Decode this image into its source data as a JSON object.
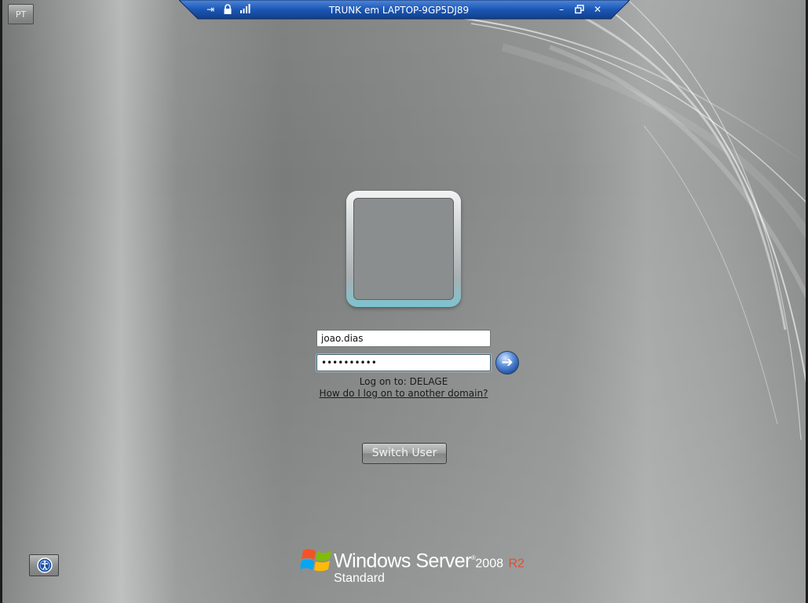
{
  "connection_bar": {
    "title": "TRUNK em LAPTOP-9GP5DJ89",
    "icons": [
      "pin-icon",
      "lock-icon",
      "signal-strength-icon",
      "minimize-icon",
      "restore-icon",
      "close-icon"
    ],
    "pin_glyph": "⇥",
    "minimize_glyph": "–",
    "close_glyph": "✕",
    "color": "#1b57b5"
  },
  "language": {
    "label": "PT"
  },
  "logon": {
    "username_value": "joao.dias",
    "password_value": "••••••••••",
    "submit_glyph": "➔",
    "logon_to": "Log on to: DELAGE",
    "other_domain_link": "How do I log on to another domain?",
    "switch_user_label": "Switch User"
  },
  "ease_of_access": {
    "icon": "ease-of-access-icon"
  },
  "branding": {
    "product": "Windows Server",
    "tm": "®",
    "year": "2008",
    "release": "R2",
    "edition": "Standard",
    "accent": "#e0502a"
  }
}
